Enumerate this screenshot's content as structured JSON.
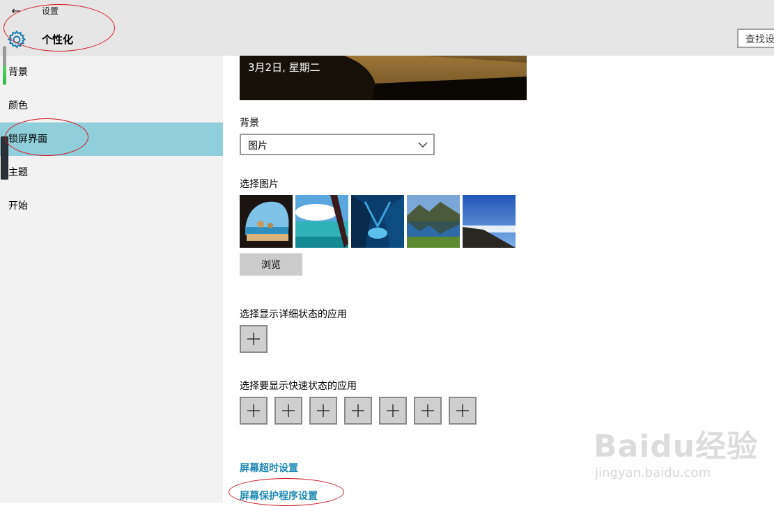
{
  "titlebar": {
    "app_title": "设置",
    "page_heading": "个性化",
    "search_text": "查找设",
    "back_icon": "back-arrow-icon",
    "settings_icon": "gear-icon"
  },
  "sidebar": {
    "items": [
      {
        "label": "背景"
      },
      {
        "label": "颜色"
      },
      {
        "label": "锁屏界面"
      },
      {
        "label": "主题"
      },
      {
        "label": "开始"
      }
    ],
    "active_color": "#91cedb"
  },
  "main": {
    "preview_date": "3月2日, 星期二",
    "background_label": "背景",
    "background_value": "图片",
    "choose_picture_label": "选择图片",
    "browse_label": "浏览",
    "detailed_status_label": "选择显示详细状态的应用",
    "quick_status_label": "选择要显示快速状态的应用",
    "quick_status_slots": 7,
    "timeout_link": "屏幕超时设置",
    "screensaver_link": "屏幕保护程序设置",
    "link_color": "#1e8ab5"
  },
  "watermark": {
    "brand": "Baidu经验",
    "url": "jingyan.baidu.com"
  }
}
